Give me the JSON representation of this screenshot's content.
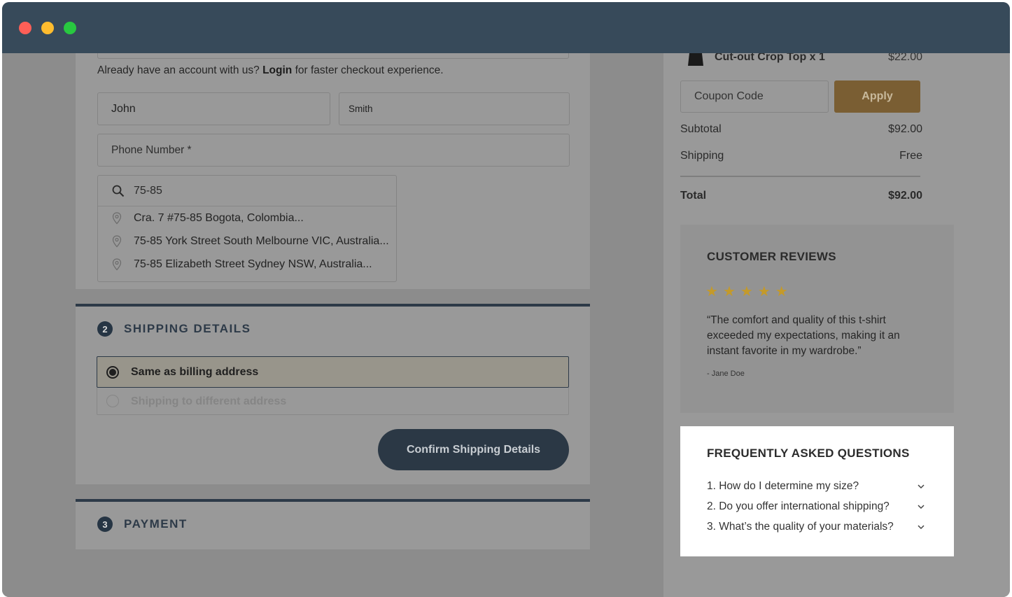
{
  "window": {
    "controls": [
      "close",
      "minimize",
      "zoom"
    ]
  },
  "billing": {
    "account_prompt": "Already have an account with us?",
    "login_link": "Login",
    "account_suffix": "for faster checkout experience.",
    "first_name_value": "John",
    "last_name_value": "Smith",
    "phone_placeholder": "Phone Number *",
    "address_search_value": "75-85",
    "address_suggestions": [
      "Cra. 7 #75-85 Bogota, Colombia...",
      "75-85 York Street South Melbourne VIC, Australia...",
      "75-85 Elizabeth Street Sydney NSW, Australia..."
    ]
  },
  "shipping": {
    "step_number": "2",
    "title": "SHIPPING DETAILS",
    "options": [
      {
        "label": "Same as billing address",
        "selected": true
      },
      {
        "label": "Shipping to different address",
        "selected": false
      }
    ],
    "confirm_label": "Confirm Shipping Details"
  },
  "payment": {
    "step_number": "3",
    "title": "PAYMENT"
  },
  "order": {
    "item_name": "Cut-out Crop Top x 1",
    "item_price": "$22.00",
    "coupon_placeholder": "Coupon Code",
    "apply_label": "Apply",
    "subtotal_label": "Subtotal",
    "subtotal_value": "$92.00",
    "shipping_label": "Shipping",
    "shipping_value": "Free",
    "total_label": "Total",
    "total_value": "$92.00"
  },
  "reviews": {
    "heading": "CUSTOMER REVIEWS",
    "rating": 5,
    "quote": "“The comfort and quality of this t-shirt exceeded my expectations, making it an instant favorite in my wardrobe.”",
    "author": "- Jane Doe"
  },
  "faq": {
    "heading": "FREQUENTLY ASKED QUESTIONS",
    "items": [
      "1. How do I determine my size?",
      "2. Do you offer international shipping?",
      "3. What’s the quality of your materials?"
    ]
  },
  "colors": {
    "titlebar": "#374a5a",
    "brand_dark": "#2b3845",
    "accent_gold": "#7a5e33",
    "star": "#c49a2a"
  }
}
